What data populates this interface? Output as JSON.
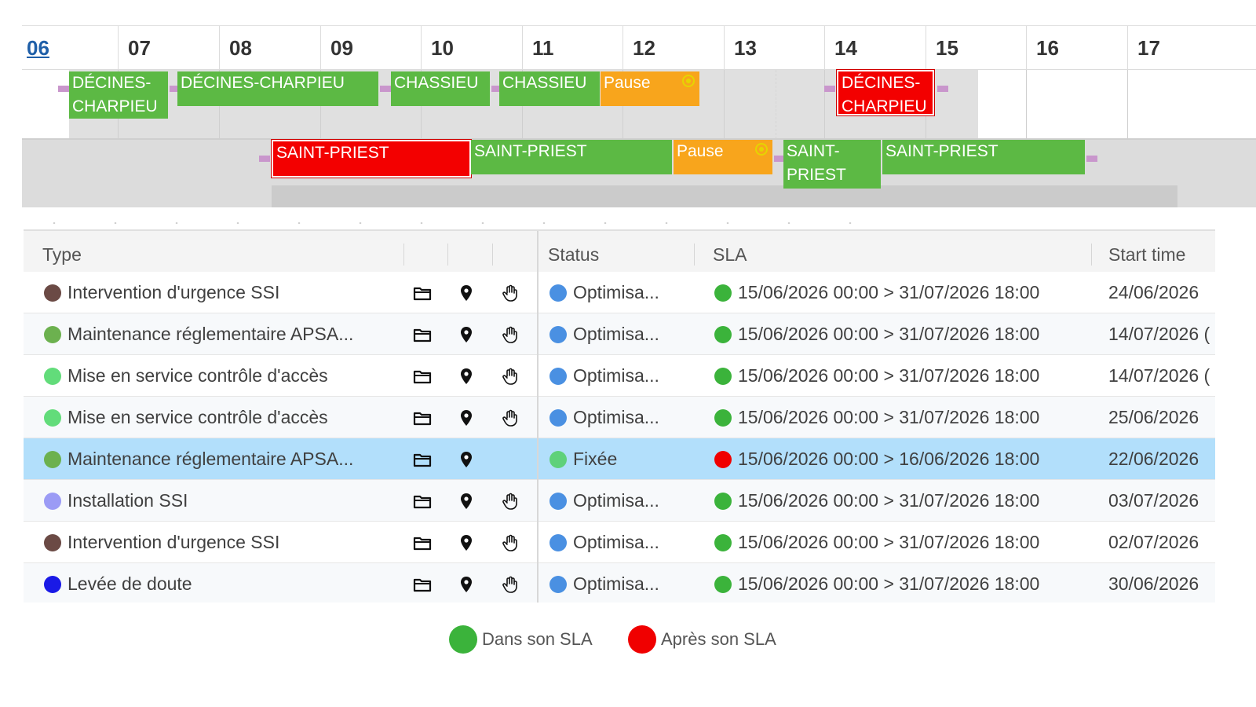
{
  "gantt": {
    "hours": [
      "06",
      "07",
      "08",
      "09",
      "10",
      "11",
      "12",
      "13",
      "14",
      "15",
      "16",
      "17"
    ],
    "row1": [
      {
        "label": "DÉCINES-CHARPIEU",
        "status": "green"
      },
      {
        "label": "DÉCINES-CHARPIEU",
        "status": "green"
      },
      {
        "label": "CHASSIEU",
        "status": "green"
      },
      {
        "label": "CHASSIEU",
        "status": "green"
      },
      {
        "label": "Pause",
        "status": "orange"
      },
      {
        "label": "DÉCINES-CHARPIEU",
        "status": "red"
      }
    ],
    "row2": [
      {
        "label": "SAINT-PRIEST",
        "status": "red"
      },
      {
        "label": "SAINT-PRIEST",
        "status": "green"
      },
      {
        "label": "Pause",
        "status": "orange"
      },
      {
        "label": "SAINT-PRIEST",
        "status": "green"
      },
      {
        "label": "SAINT-PRIEST",
        "status": "green"
      }
    ]
  },
  "table": {
    "headers": {
      "type": "Type",
      "status": "Status",
      "sla": "SLA",
      "start": "Start time"
    },
    "rows": [
      {
        "type": "Intervention d'urgence SSI",
        "type_color": "#6b4a45",
        "status": "Optimisa...",
        "status_color": "#4a90e2",
        "sla": "15/06/2026 00:00 > 31/07/2026 18:00",
        "sla_color": "#3bb33b",
        "start": "24/06/2026",
        "hand": true
      },
      {
        "type": "Maintenance réglementaire APSA...",
        "type_color": "#6cb14f",
        "status": "Optimisa...",
        "status_color": "#4a90e2",
        "sla": "15/06/2026 00:00 > 31/07/2026 18:00",
        "sla_color": "#3bb33b",
        "start": "14/07/2026 (",
        "hand": true
      },
      {
        "type": "Mise en service contrôle d'accès",
        "type_color": "#62dc7a",
        "status": "Optimisa...",
        "status_color": "#4a90e2",
        "sla": "15/06/2026 00:00 > 31/07/2026 18:00",
        "sla_color": "#3bb33b",
        "start": "14/07/2026 (",
        "hand": true
      },
      {
        "type": "Mise en service contrôle d'accès",
        "type_color": "#62dc7a",
        "status": "Optimisa...",
        "status_color": "#4a90e2",
        "sla": "15/06/2026 00:00 > 31/07/2026 18:00",
        "sla_color": "#3bb33b",
        "start": "25/06/2026",
        "hand": true
      },
      {
        "type": "Maintenance réglementaire APSA...",
        "type_color": "#6cb14f",
        "status": "Fixée",
        "status_color": "#5fd17a",
        "sla": "15/06/2026 00:00 > 16/06/2026 18:00",
        "sla_color": "#f00000",
        "start": "22/06/2026",
        "hand": false,
        "selected": true
      },
      {
        "type": "Installation SSI",
        "type_color": "#9b9bf5",
        "status": "Optimisa...",
        "status_color": "#4a90e2",
        "sla": "15/06/2026 00:00 > 31/07/2026 18:00",
        "sla_color": "#3bb33b",
        "start": "03/07/2026",
        "hand": true
      },
      {
        "type": "Intervention d'urgence SSI",
        "type_color": "#6b4a45",
        "status": "Optimisa...",
        "status_color": "#4a90e2",
        "sla": "15/06/2026 00:00 > 31/07/2026 18:00",
        "sla_color": "#3bb33b",
        "start": "02/07/2026",
        "hand": true
      },
      {
        "type": "Levée de doute",
        "type_color": "#1a1ae6",
        "status": "Optimisa...",
        "status_color": "#4a90e2",
        "sla": "15/06/2026 00:00 > 31/07/2026 18:00",
        "sla_color": "#3bb33b",
        "start": "30/06/2026",
        "hand": true
      }
    ]
  },
  "legend": [
    {
      "label": "Dans son SLA",
      "color": "#3bb33b"
    },
    {
      "label": "Après son SLA",
      "color": "#f00000"
    }
  ],
  "icons": [
    "folder-icon",
    "location-pin-icon",
    "hand-icon",
    "pause-clock-icon"
  ]
}
